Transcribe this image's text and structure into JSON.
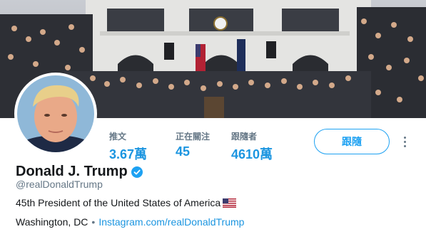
{
  "profile": {
    "name": "Donald J. Trump",
    "handle": "@realDonaldTrump",
    "bio": "45th President of the United States of America",
    "location": "Washington, DC",
    "separator": "•",
    "website": "Instagram.com/realDonaldTrump"
  },
  "stats": [
    {
      "label": "推文",
      "value": "3.67萬"
    },
    {
      "label": "正在關注",
      "value": "45"
    },
    {
      "label": "跟隨者",
      "value": "4610萬"
    }
  ],
  "actions": {
    "follow_label": "跟隨"
  },
  "colors": {
    "accent": "#1da1f2",
    "link": "#1b95e0",
    "muted": "#657786",
    "text": "#14171a"
  },
  "icons": [
    "verified-badge-icon",
    "us-flag-icon",
    "more-options-icon"
  ]
}
